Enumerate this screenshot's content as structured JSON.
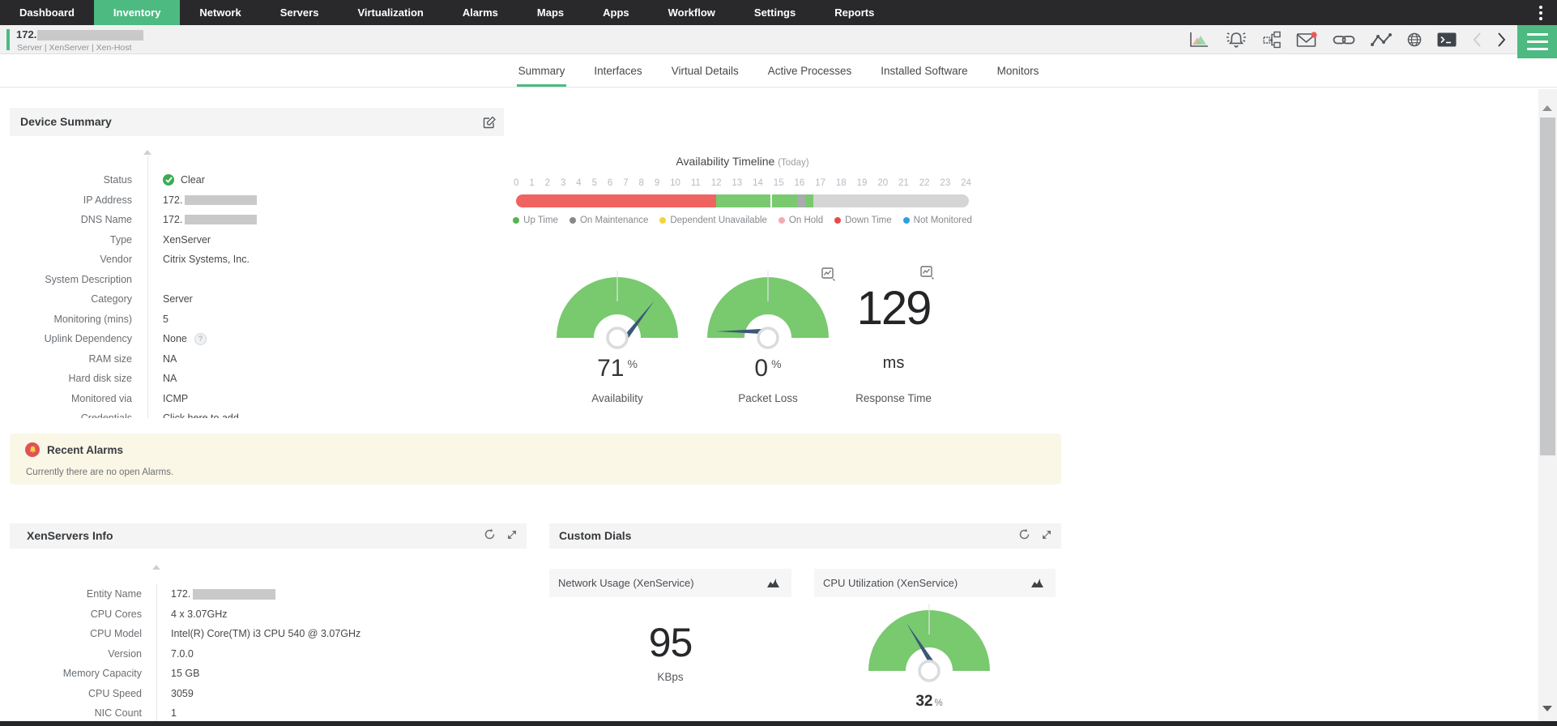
{
  "navbar": {
    "items": [
      {
        "label": "Dashboard",
        "active": false
      },
      {
        "label": "Inventory",
        "active": true
      },
      {
        "label": "Network",
        "active": false
      },
      {
        "label": "Servers",
        "active": false
      },
      {
        "label": "Virtualization",
        "active": false
      },
      {
        "label": "Alarms",
        "active": false
      },
      {
        "label": "Maps",
        "active": false
      },
      {
        "label": "Apps",
        "active": false
      },
      {
        "label": "Workflow",
        "active": false
      },
      {
        "label": "Settings",
        "active": false
      },
      {
        "label": "Reports",
        "active": false
      }
    ]
  },
  "device_header": {
    "title_prefix": "172.",
    "breadcrumb": "Server | XenServer | Xen-Host",
    "icons": [
      "area-chart",
      "alarm-bell",
      "workflow",
      "mail",
      "link",
      "line-graph",
      "globe",
      "terminal",
      "chevron-left",
      "chevron-right",
      "menu"
    ]
  },
  "tabs": [
    {
      "label": "Summary",
      "active": true
    },
    {
      "label": "Interfaces",
      "active": false
    },
    {
      "label": "Virtual Details",
      "active": false
    },
    {
      "label": "Active Processes",
      "active": false
    },
    {
      "label": "Installed Software",
      "active": false
    },
    {
      "label": "Monitors",
      "active": false
    }
  ],
  "device_summary": {
    "title": "Device Summary",
    "fields": [
      {
        "label": "Status",
        "value": "Clear",
        "type": "status"
      },
      {
        "label": "IP Address",
        "value": "172.",
        "type": "redacted"
      },
      {
        "label": "DNS Name",
        "value": "172.",
        "type": "redacted"
      },
      {
        "label": "Type",
        "value": "XenServer",
        "type": "plain"
      },
      {
        "label": "Vendor",
        "value": "Citrix Systems, Inc.",
        "type": "plain"
      },
      {
        "label": "System Description",
        "value": "",
        "type": "plain"
      },
      {
        "label": "Category",
        "value": "Server",
        "type": "plain"
      },
      {
        "label": "Monitoring (mins)",
        "value": "5",
        "type": "plain"
      },
      {
        "label": "Uplink Dependency",
        "value": "None",
        "type": "help"
      },
      {
        "label": "RAM size",
        "value": "NA",
        "type": "plain"
      },
      {
        "label": "Hard disk size",
        "value": "NA",
        "type": "plain"
      },
      {
        "label": "Monitored via",
        "value": "ICMP",
        "type": "plain"
      },
      {
        "label": "Credentials",
        "value": "Click here to add",
        "type": "plain"
      }
    ]
  },
  "availability_timeline": {
    "title": "Availability Timeline",
    "subtitle": "(Today)",
    "hour_labels": [
      "0",
      "1",
      "2",
      "3",
      "4",
      "5",
      "6",
      "7",
      "8",
      "9",
      "10",
      "11",
      "12",
      "13",
      "14",
      "15",
      "16",
      "17",
      "18",
      "19",
      "20",
      "21",
      "22",
      "23",
      "24"
    ],
    "segments": [
      {
        "status": "down",
        "color": "#ef6360",
        "pct": 44.2
      },
      {
        "status": "up",
        "color": "#79c96f",
        "pct": 12.0
      },
      {
        "status": "gap",
        "color": "#ffffff",
        "pct": 0.4
      },
      {
        "status": "up",
        "color": "#79c96f",
        "pct": 5.4
      },
      {
        "status": "maintenance",
        "color": "#a9abad",
        "pct": 1.8
      },
      {
        "status": "up",
        "color": "#79c96f",
        "pct": 1.8
      },
      {
        "status": "future",
        "color": "#d5d5d5",
        "pct": 34.4
      }
    ],
    "legend": [
      {
        "label": "Up Time",
        "color": "#54b64e"
      },
      {
        "label": "On Maintenance",
        "color": "#85898c"
      },
      {
        "label": "Dependent Unavailable",
        "color": "#f2d53c"
      },
      {
        "label": "On Hold",
        "color": "#f5a9b0"
      },
      {
        "label": "Down Time",
        "color": "#e44b4b"
      },
      {
        "label": "Not Monitored",
        "color": "#2e9fe0"
      }
    ]
  },
  "metrics": {
    "availability": {
      "value": "71",
      "unit": "%",
      "label": "Availability",
      "gauge_percent": 71
    },
    "packet_loss": {
      "value": "0",
      "unit": "%",
      "label": "Packet Loss",
      "gauge_percent": 0
    },
    "response_time": {
      "value": "129",
      "unit": "ms",
      "label": "Response Time"
    }
  },
  "recent_alarms": {
    "title": "Recent Alarms",
    "message": "Currently there are no open Alarms."
  },
  "xenservers_info": {
    "title": "XenServers Info",
    "fields": [
      {
        "label": "Entity Name",
        "value": "172.",
        "type": "redacted"
      },
      {
        "label": "CPU Cores",
        "value": "4 x 3.07GHz",
        "type": "plain"
      },
      {
        "label": "CPU Model",
        "value": "Intel(R) Core(TM) i3 CPU 540 @ 3.07GHz",
        "type": "plain"
      },
      {
        "label": "Version",
        "value": "7.0.0",
        "type": "plain"
      },
      {
        "label": "Memory Capacity",
        "value": "15 GB",
        "type": "plain"
      },
      {
        "label": "CPU Speed",
        "value": "3059",
        "type": "plain"
      },
      {
        "label": "NIC Count",
        "value": "1",
        "type": "plain"
      }
    ]
  },
  "custom_dials": {
    "title": "Custom Dials",
    "dials": [
      {
        "title": "Network Usage (XenService)",
        "value": "95",
        "unit": "KBps",
        "display": "number"
      },
      {
        "title": "CPU Utilization (XenService)",
        "value": "32",
        "unit": "%",
        "display": "gauge",
        "gauge_percent": 32
      }
    ]
  },
  "colors": {
    "accent_green": "#4dba82",
    "gauge_green": "#79c96f",
    "needle": "#3c5877",
    "down_red": "#ef6360",
    "alarm_red": "#df5354"
  }
}
